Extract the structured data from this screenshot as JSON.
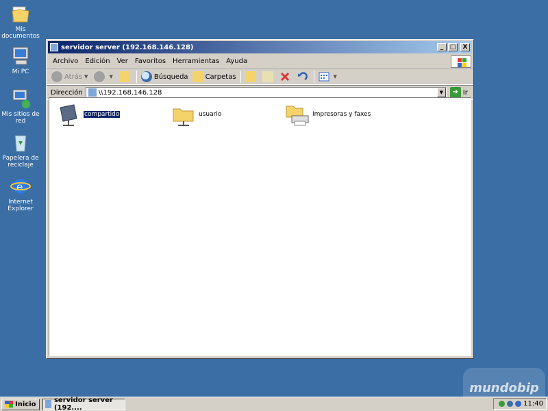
{
  "desktop": {
    "icons": [
      {
        "label": "Mis documentos",
        "icon": "my-documents-icon"
      },
      {
        "label": "Mi PC",
        "icon": "my-computer-icon"
      },
      {
        "label": "Mis sitios de red",
        "icon": "network-places-icon"
      },
      {
        "label": "Papelera de reciclaje",
        "icon": "recycle-bin-icon"
      },
      {
        "label": "Internet Explorer",
        "icon": "internet-explorer-icon"
      }
    ]
  },
  "window": {
    "title": "servidor server (192.168.146.128)",
    "controls": {
      "minimize": "_",
      "maximize": "□",
      "close": "X"
    },
    "menu": [
      "Archivo",
      "Edición",
      "Ver",
      "Favoritos",
      "Herramientas",
      "Ayuda"
    ],
    "toolbar": {
      "back": "Atrás",
      "search": "Búsqueda",
      "folders": "Carpetas"
    },
    "address": {
      "label": "Dirección",
      "value": "\\\\192.168.146.128",
      "go": "Ir"
    },
    "items": [
      {
        "label": "compartido",
        "icon": "network-share-icon",
        "selected": true
      },
      {
        "label": "usuario",
        "icon": "shared-folder-icon",
        "selected": false
      },
      {
        "label": "Impresoras y faxes",
        "icon": "printers-faxes-icon",
        "selected": false
      }
    ]
  },
  "taskbar": {
    "start": "Inicio",
    "task": "servidor server (192....",
    "clock": "11:40"
  },
  "watermark": "mundobip",
  "colors": {
    "desktop": "#3a6ea5",
    "titlebar": "#0a246a",
    "selection": "#0a246a"
  }
}
